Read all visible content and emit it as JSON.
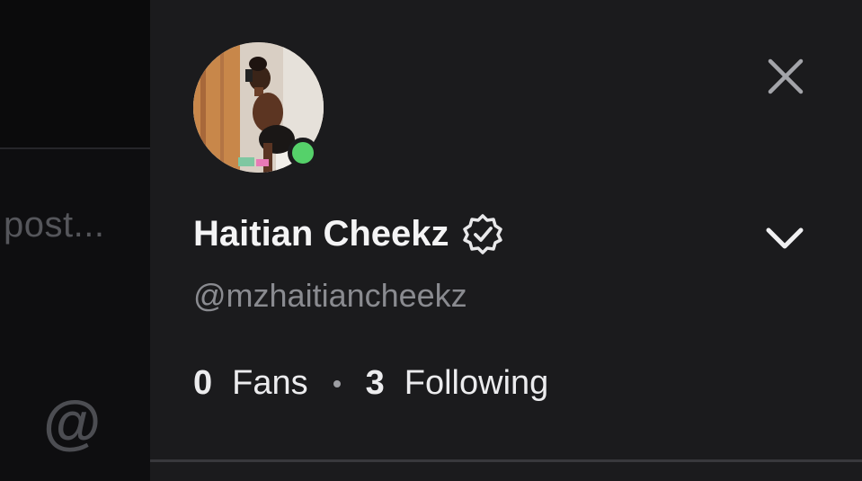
{
  "background": {
    "post_placeholder": "post...",
    "mention_icon": "@"
  },
  "profile": {
    "display_name": "Haitian Cheekz",
    "handle": "@mzhaitiancheekz",
    "verified_icon": "verified-badge-icon",
    "online_status_color": "#55d16a",
    "fans_count": "0",
    "fans_label": "Fans",
    "following_count": "3",
    "following_label": "Following"
  },
  "actions": {
    "close_icon": "close-icon",
    "expand_icon": "chevron-down-icon"
  }
}
